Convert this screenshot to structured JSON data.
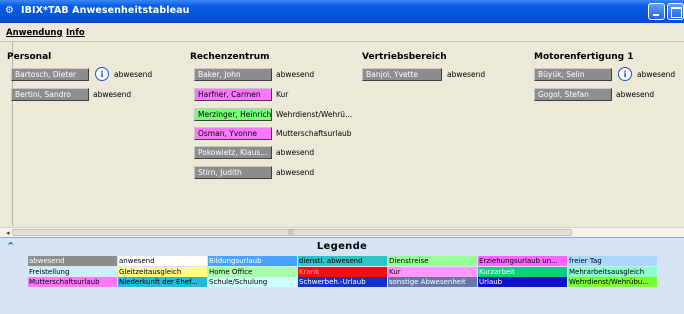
{
  "window": {
    "title": "IBIX*TAB Anwesenheitstableau",
    "app_icon": "gear-icon"
  },
  "menu": {
    "items": [
      "Anwendung",
      "Info"
    ]
  },
  "columns": [
    {
      "title": "Personal",
      "people": [
        {
          "name": "Bartosch, Dieter",
          "status": "abwesend",
          "color": "#8d8d8d",
          "info_icon": true
        },
        {
          "name": "Bertini, Sandro",
          "status": "abwesend",
          "color": "#8d8d8d",
          "info_icon": false
        }
      ]
    },
    {
      "title": "Rechenzentrum",
      "people": [
        {
          "name": "Baker, John",
          "status": "abwesend",
          "color": "#8d8d8d",
          "info_icon": false
        },
        {
          "name": "Harfner, Carmen",
          "status": "Kur",
          "color": "#ff77ff",
          "info_icon": false
        },
        {
          "name": "Merzinger, Heinrich",
          "status": "Wehrdienst/Wehrü...",
          "color": "#77ff77",
          "info_icon": false
        },
        {
          "name": "Osman, Yvonne",
          "status": "Mutterschaftsurlaub",
          "color": "#ff77ff",
          "info_icon": false
        },
        {
          "name": "Pokowietz, Klaus...",
          "status": "abwesend",
          "color": "#8d8d8d",
          "info_icon": false
        },
        {
          "name": "Stirn, Judith",
          "status": "abwesend",
          "color": "#8d8d8d",
          "info_icon": false
        }
      ]
    },
    {
      "title": "Vertriebsbereich",
      "people": [
        {
          "name": "Banjol, Yvette",
          "status": "abwesend",
          "color": "#8d8d8d",
          "info_icon": false
        }
      ]
    },
    {
      "title": "Motorenfertigung 1",
      "people": [
        {
          "name": "Büyük, Selin",
          "status": "abwesend",
          "color": "#8d8d8d",
          "info_icon": true
        },
        {
          "name": "Gogol, Stefan",
          "status": "abwesend",
          "color": "#8d8d8d",
          "info_icon": false
        }
      ]
    }
  ],
  "legend": {
    "title": "Legende",
    "collapse_icon": "collapse-arrow-icon",
    "rows": [
      [
        {
          "label": "abwesend",
          "bg": "#8d8d8d",
          "fg": "#ffffff"
        },
        {
          "label": "anwesend",
          "bg": "#ffffff",
          "fg": "#000000"
        },
        {
          "label": "Bildungsurlaub",
          "bg": "#4aa3ff",
          "fg": "#ffffff"
        },
        {
          "label": "dienstl. abwesend",
          "bg": "#2cc4c4",
          "fg": "#000000"
        },
        {
          "label": "Dienstreise",
          "bg": "#99ff99",
          "fg": "#000000"
        },
        {
          "label": "Erziehungsurlaub un...",
          "bg": "#ff66ff",
          "fg": "#000000"
        },
        {
          "label": "freier Tag",
          "bg": "#aad8ff",
          "fg": "#000000"
        }
      ],
      [
        {
          "label": "Freistellung",
          "bg": "#cfeef8",
          "fg": "#000000"
        },
        {
          "label": "Gleitzeitausgleich",
          "bg": "#ffff88",
          "fg": "#000000"
        },
        {
          "label": "Home Office",
          "bg": "#aaffaa",
          "fg": "#000000"
        },
        {
          "label": "Krank",
          "bg": "#ee1111",
          "fg": "#ff9999"
        },
        {
          "label": "Kur",
          "bg": "#ff99ff",
          "fg": "#000000"
        },
        {
          "label": "Kurzarbeit",
          "bg": "#11cc88",
          "fg": "#ffffff"
        },
        {
          "label": "Mehrarbeitsausgleich",
          "bg": "#88ffcc",
          "fg": "#000000"
        }
      ],
      [
        {
          "label": "Mutterschaftsurlaub",
          "bg": "#ff77ff",
          "fg": "#000000"
        },
        {
          "label": "Niederkunft der Ehef...",
          "bg": "#22bbdd",
          "fg": "#000000"
        },
        {
          "label": "Schule/Schulung",
          "bg": "#ccffff",
          "fg": "#000000"
        },
        {
          "label": "Schwerbeh.-Urlaub",
          "bg": "#1133cc",
          "fg": "#ffffff"
        },
        {
          "label": "sonstige Abwesenheit",
          "bg": "#6677aa",
          "fg": "#ffffff"
        },
        {
          "label": "Urlaub",
          "bg": "#1111cc",
          "fg": "#ffffff"
        },
        {
          "label": "Wehrdienst/Wehrübu...",
          "bg": "#77ff33",
          "fg": "#000000"
        }
      ]
    ]
  }
}
